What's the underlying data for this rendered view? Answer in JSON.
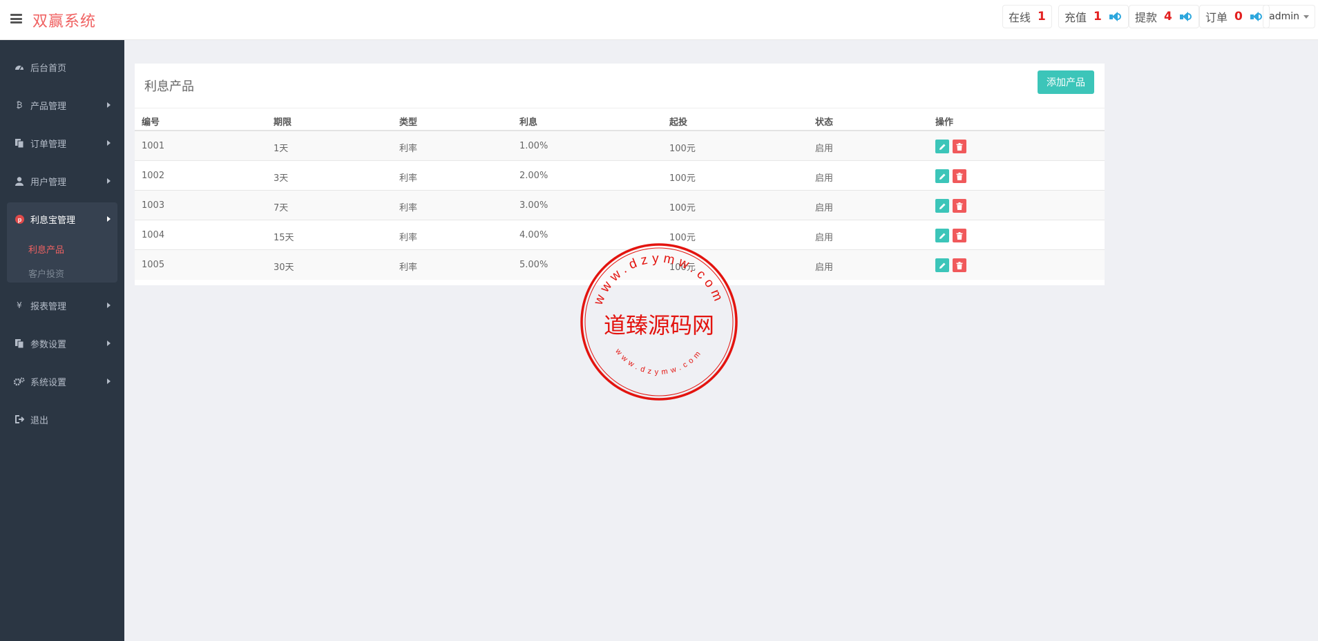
{
  "header": {
    "brand": "双赢系统",
    "stats": [
      {
        "label": "在线",
        "value": "1"
      },
      {
        "label": "充值",
        "value": "1"
      },
      {
        "label": "提款",
        "value": "4"
      },
      {
        "label": "订单",
        "value": "0"
      }
    ],
    "user": "admin"
  },
  "sidebar": {
    "items": [
      {
        "label": "后台首页",
        "icon": "dashboard-icon"
      },
      {
        "label": "产品管理",
        "icon": "bitcoin-icon"
      },
      {
        "label": "订单管理",
        "icon": "copy-icon"
      },
      {
        "label": "用户管理",
        "icon": "user-icon"
      },
      {
        "label": "利息宝管理",
        "icon": "pinterest-icon"
      },
      {
        "label": "报表管理",
        "icon": "yen-icon"
      },
      {
        "label": "参数设置",
        "icon": "copy-icon"
      },
      {
        "label": "系统设置",
        "icon": "gears-icon"
      },
      {
        "label": "退出",
        "icon": "sign-out-icon"
      }
    ],
    "subitems": [
      {
        "label": "利息产品"
      },
      {
        "label": "客户投资"
      }
    ]
  },
  "panel": {
    "title": "利息产品",
    "add_button": "添加产品",
    "columns": [
      "编号",
      "期限",
      "类型",
      "利息",
      "起投",
      "状态",
      "操作"
    ],
    "rows": [
      [
        "1001",
        "1天",
        "利率",
        "1.00%",
        "100元",
        "启用"
      ],
      [
        "1002",
        "3天",
        "利率",
        "2.00%",
        "100元",
        "启用"
      ],
      [
        "1003",
        "7天",
        "利率",
        "3.00%",
        "100元",
        "启用"
      ],
      [
        "1004",
        "15天",
        "利率",
        "4.00%",
        "100元",
        "启用"
      ],
      [
        "1005",
        "30天",
        "利率",
        "5.00%",
        "100元",
        "启用"
      ]
    ]
  },
  "watermark": {
    "main": "道臻源码网",
    "top_ring": "www.dzymw.com",
    "bottom_ring": "www.dzymw.com"
  },
  "colors": {
    "brand": "#f06262",
    "sidebar": "#2b3643",
    "accent": "#3cc5b9",
    "danger": "#f0595b",
    "badge": "#e32020"
  }
}
